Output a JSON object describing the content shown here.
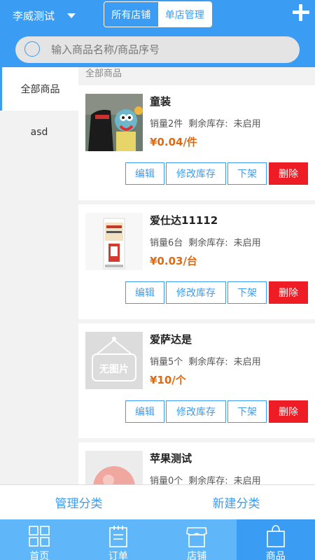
{
  "header": {
    "store_name": "李威测试",
    "segments": [
      "所有店铺",
      "单店管理"
    ],
    "icons": {
      "dropdown": "caret-down-icon",
      "add": "plus-icon"
    }
  },
  "search": {
    "placeholder": "输入商品名称/商品序号",
    "icon": "search-icon"
  },
  "sidebar": {
    "items": [
      {
        "label": "全部商品",
        "active": true
      },
      {
        "label": "asd",
        "active": false
      }
    ]
  },
  "main": {
    "section_title": "全部商品",
    "products": [
      {
        "name": "童装",
        "sales": "销量2件",
        "stock": "剩余库存:",
        "stock_value": "未启用",
        "price": "¥0.04/件"
      },
      {
        "name": "爱仕达11112",
        "sales": "销量6台",
        "stock": "剩余库存:",
        "stock_value": "未启用",
        "price": "¥0.03/台"
      },
      {
        "name": "爱萨达是",
        "sales": "销量5个",
        "stock": "剩余库存:",
        "stock_value": "未启用",
        "price": "¥10/个",
        "placeholder_text": "无图片"
      },
      {
        "name": "苹果测试",
        "sales": "销量0个",
        "stock": "剩余库存:",
        "stock_value": "未启用",
        "price": ""
      }
    ],
    "actions": {
      "edit": "编辑",
      "stock": "修改库存",
      "off": "下架",
      "delete": "删除"
    }
  },
  "category_bar": {
    "manage": "管理分类",
    "create": "新建分类"
  },
  "tabbar": {
    "items": [
      {
        "label": "首页",
        "icon": "grid-home-icon"
      },
      {
        "label": "订单",
        "icon": "clipboard-icon"
      },
      {
        "label": "店铺",
        "icon": "store-icon"
      },
      {
        "label": "商品",
        "icon": "shopping-bag-icon",
        "active": true
      }
    ]
  },
  "colors": {
    "primary": "#3a9cf3",
    "tabbar": "#5fb6f8",
    "price": "#e06a12",
    "delete": "#ee1c24"
  }
}
